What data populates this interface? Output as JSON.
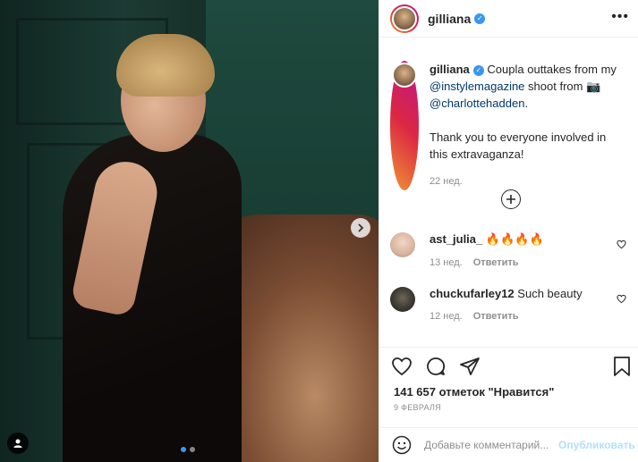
{
  "post": {
    "author": "gilliana",
    "caption_author": "gilliana",
    "caption_parts": {
      "part1": "Coupla outtakes from my",
      "mention1": "@instylemagazine",
      "part2": "shoot from 📷",
      "mention2": "@charlottehadden",
      "part3": ".",
      "paragraph2": "Thank you to everyone involved in this extravaganza!"
    },
    "caption_time": "22 нед.",
    "likes": "141 657 отметок \"Нравится\"",
    "date": "9 ФЕВРАЛЯ"
  },
  "comments": [
    {
      "user": "ast_julia_",
      "text": "🔥🔥🔥🔥",
      "time": "13 нед.",
      "reply": "Ответить"
    },
    {
      "user": "chuckufarley12",
      "text": "Such beauty",
      "time": "12 нед.",
      "reply": "Ответить"
    }
  ],
  "composer": {
    "placeholder": "Добавьте комментарий...",
    "publish": "Опубликовать"
  },
  "carousel": {
    "current": 1,
    "total": 2
  },
  "colors": {
    "verified": "#3897f0",
    "link": "#00376b",
    "publish_disabled": "#b2dffc"
  }
}
